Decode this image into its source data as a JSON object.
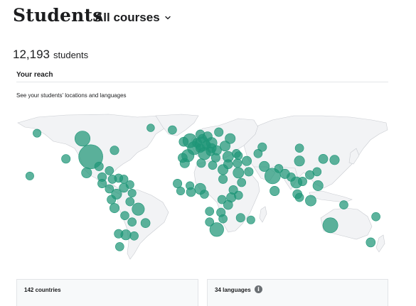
{
  "header": {
    "title": "Students",
    "course_filter": {
      "selected": "All courses",
      "icon": "chevron-down-icon"
    }
  },
  "summary": {
    "count": "12,193",
    "unit": "students"
  },
  "reach": {
    "title": "Your reach",
    "description": "See your students' locations and languages"
  },
  "map": {
    "land_color": "#f2f3f5",
    "border_color": "#c9ccd1",
    "bubble_color": "#1e9577",
    "bubbles": [
      {
        "lat": 39,
        "lon": -98,
        "weight": 1.0
      },
      {
        "lat": 56,
        "lon": -106,
        "weight": 0.34
      },
      {
        "lat": 54,
        "lon": -2,
        "weight": 0.28
      },
      {
        "lat": 51,
        "lon": 10,
        "weight": 0.3
      },
      {
        "lat": 47,
        "lon": 2,
        "weight": 0.24
      },
      {
        "lat": 21,
        "lon": 78,
        "weight": 0.36
      },
      {
        "lat": -25,
        "lon": 134,
        "weight": 0.33
      },
      {
        "lat": -29,
        "lon": 24,
        "weight": 0.27
      },
      {
        "lat": -10,
        "lon": -52,
        "weight": 0.2
      },
      {
        "lat": 40,
        "lon": -4,
        "weight": 0.2
      },
      {
        "lat": 42,
        "lon": 12,
        "weight": 0.2
      },
      {
        "lat": 52,
        "lon": 19,
        "weight": 0.14
      },
      {
        "lat": 39,
        "lon": 35,
        "weight": 0.14
      },
      {
        "lat": 24,
        "lon": 45,
        "weight": 0.14
      },
      {
        "lat": 27,
        "lon": 30,
        "weight": 0.12
      },
      {
        "lat": 15,
        "lon": 101,
        "weight": 0.16
      },
      {
        "lat": 9,
        "lon": 8,
        "weight": 0.15
      },
      {
        "lat": 56,
        "lon": 37,
        "weight": 0.12
      },
      {
        "lat": 36,
        "lon": 138,
        "weight": 0.1
      },
      {
        "lat": 35,
        "lon": 104,
        "weight": 0.12
      },
      {
        "lat": 12,
        "lon": 122,
        "weight": 0.12
      },
      {
        "lat": -2,
        "lon": 115,
        "weight": 0.14
      },
      {
        "lat": 24,
        "lon": -102,
        "weight": 0.12
      },
      {
        "lat": 4,
        "lon": -73,
        "weight": 0.12
      },
      {
        "lat": -34,
        "lon": -64,
        "weight": 0.12
      },
      {
        "lat": -9,
        "lon": -75,
        "weight": 0.1
      },
      {
        "lat": 30,
        "lon": 70,
        "weight": 0.12
      },
      {
        "lat": 49,
        "lon": 32,
        "weight": 0.12
      },
      {
        "lat": 33,
        "lon": -7,
        "weight": 0.1
      },
      {
        "lat": 7,
        "lon": 80,
        "weight": 0.1
      },
      {
        "lat": 1,
        "lon": 38,
        "weight": 0.1
      },
      {
        "lat": 35,
        "lon": 53,
        "weight": 0.1
      },
      {
        "lat": 58,
        "lon": 15,
        "weight": 0.1
      },
      {
        "lat": 62,
        "lon": 26,
        "weight": 0.08
      },
      {
        "lat": 60,
        "lon": 8,
        "weight": 0.08
      },
      {
        "lat": 37,
        "lon": 127,
        "weight": 0.09
      },
      {
        "lat": -41,
        "lon": 173,
        "weight": 0.09
      },
      {
        "lat": -18,
        "lon": 47,
        "weight": 0.08
      },
      {
        "lat": 23,
        "lon": 90,
        "weight": 0.1
      },
      {
        "lat": 33,
        "lon": 9,
        "weight": 0.08
      },
      {
        "lat": 20,
        "lon": -87,
        "weight": 0.08
      },
      {
        "lat": 14,
        "lon": -87,
        "weight": 0.08
      },
      {
        "lat": 10,
        "lon": -66,
        "weight": 0.09
      },
      {
        "lat": -1,
        "lon": -78,
        "weight": 0.08
      },
      {
        "lat": -16,
        "lon": -65,
        "weight": 0.07
      },
      {
        "lat": -22,
        "lon": -58,
        "weight": 0.07
      },
      {
        "lat": 6,
        "lon": -1,
        "weight": 0.09
      },
      {
        "lat": 14,
        "lon": -14,
        "weight": 0.08
      },
      {
        "lat": 18,
        "lon": 30,
        "weight": 0.08
      },
      {
        "lat": -6,
        "lon": 35,
        "weight": 0.09
      },
      {
        "lat": -13,
        "lon": 28,
        "weight": 0.08
      },
      {
        "lat": -1,
        "lon": 29,
        "weight": 0.07
      },
      {
        "lat": 3,
        "lon": 45,
        "weight": 0.07
      },
      {
        "lat": 8,
        "lon": 40,
        "weight": 0.08
      },
      {
        "lat": 15,
        "lon": 48,
        "weight": 0.07
      },
      {
        "lat": 42,
        "lon": 64,
        "weight": 0.07
      },
      {
        "lat": 48,
        "lon": 68,
        "weight": 0.08
      },
      {
        "lat": 47,
        "lon": 104,
        "weight": 0.07
      },
      {
        "lat": 45,
        "lon": 24,
        "weight": 0.1
      },
      {
        "lat": 47,
        "lon": 19,
        "weight": 0.09
      },
      {
        "lat": 38,
        "lon": 23,
        "weight": 0.08
      },
      {
        "lat": 44,
        "lon": 18,
        "weight": 0.08
      },
      {
        "lat": 32,
        "lon": 35,
        "weight": 0.09
      },
      {
        "lat": 33,
        "lon": 44,
        "weight": 0.08
      },
      {
        "lat": 25,
        "lon": 55,
        "weight": 0.08
      },
      {
        "lat": 4,
        "lon": 102,
        "weight": 0.09
      },
      {
        "lat": 1,
        "lon": 104,
        "weight": 0.07
      },
      {
        "lat": 22,
        "lon": 114,
        "weight": 0.08
      },
      {
        "lat": 25,
        "lon": 121,
        "weight": 0.07
      },
      {
        "lat": 16,
        "lon": 107,
        "weight": 0.08
      },
      {
        "lat": 20,
        "lon": 96,
        "weight": 0.07
      },
      {
        "lat": -6,
        "lon": 147,
        "weight": 0.07
      },
      {
        "lat": -17,
        "lon": 178,
        "weight": 0.07
      },
      {
        "lat": 18,
        "lon": -77,
        "weight": 0.07
      },
      {
        "lat": 18,
        "lon": -66,
        "weight": 0.07
      },
      {
        "lat": 19,
        "lon": -71,
        "weight": 0.07
      },
      {
        "lat": 9,
        "lon": -80,
        "weight": 0.07
      },
      {
        "lat": 13,
        "lon": -60,
        "weight": 0.06
      },
      {
        "lat": 64,
        "lon": -19,
        "weight": 0.07
      },
      {
        "lat": 53,
        "lon": -8,
        "weight": 0.09
      },
      {
        "lat": 38,
        "lon": -9,
        "weight": 0.09
      },
      {
        "lat": 52,
        "lon": 5,
        "weight": 0.09
      },
      {
        "lat": 56,
        "lon": 10,
        "weight": 0.07
      },
      {
        "lat": 47,
        "lon": 8,
        "weight": 0.08
      },
      {
        "lat": 50,
        "lon": 14,
        "weight": 0.07
      },
      {
        "lat": 42,
        "lon": 43,
        "weight": 0.07
      },
      {
        "lat": 40,
        "lon": 45,
        "weight": 0.06
      },
      {
        "lat": 28,
        "lon": 84,
        "weight": 0.07
      },
      {
        "lat": 31,
        "lon": 20,
        "weight": 0.07
      },
      {
        "lat": -20,
        "lon": 57,
        "weight": 0.06
      },
      {
        "lat": -19,
        "lon": 30,
        "weight": 0.07
      },
      {
        "lat": -22,
        "lon": 17,
        "weight": 0.07
      },
      {
        "lat": -12,
        "lon": 17,
        "weight": 0.07
      },
      {
        "lat": 4,
        "lon": 12,
        "weight": 0.07
      },
      {
        "lat": 12,
        "lon": -2,
        "weight": 0.06
      },
      {
        "lat": 7,
        "lon": -11,
        "weight": 0.06
      },
      {
        "lat": -33,
        "lon": -71,
        "weight": 0.08
      },
      {
        "lat": -35,
        "lon": -56,
        "weight": 0.07
      },
      {
        "lat": -45,
        "lon": -70,
        "weight": 0.07
      },
      {
        "lat": -23,
        "lon": -45,
        "weight": 0.09
      },
      {
        "lat": -3,
        "lon": -60,
        "weight": 0.07
      },
      {
        "lat": 5,
        "lon": -58,
        "weight": 0.06
      },
      {
        "lat": 30,
        "lon": -90,
        "weight": 0.08
      },
      {
        "lat": 45,
        "lon": -75,
        "weight": 0.08
      },
      {
        "lat": 26,
        "lon": -80,
        "weight": 0.07
      },
      {
        "lat": 37,
        "lon": -122,
        "weight": 0.08
      },
      {
        "lat": 61,
        "lon": -150,
        "weight": 0.06
      },
      {
        "lat": 21,
        "lon": -157,
        "weight": 0.06
      },
      {
        "lat": 66,
        "lon": -40,
        "weight": 0.05
      }
    ]
  },
  "stats": {
    "countries_label": "142 countries",
    "languages_label": "34 languages",
    "info_icon": "info-icon"
  }
}
